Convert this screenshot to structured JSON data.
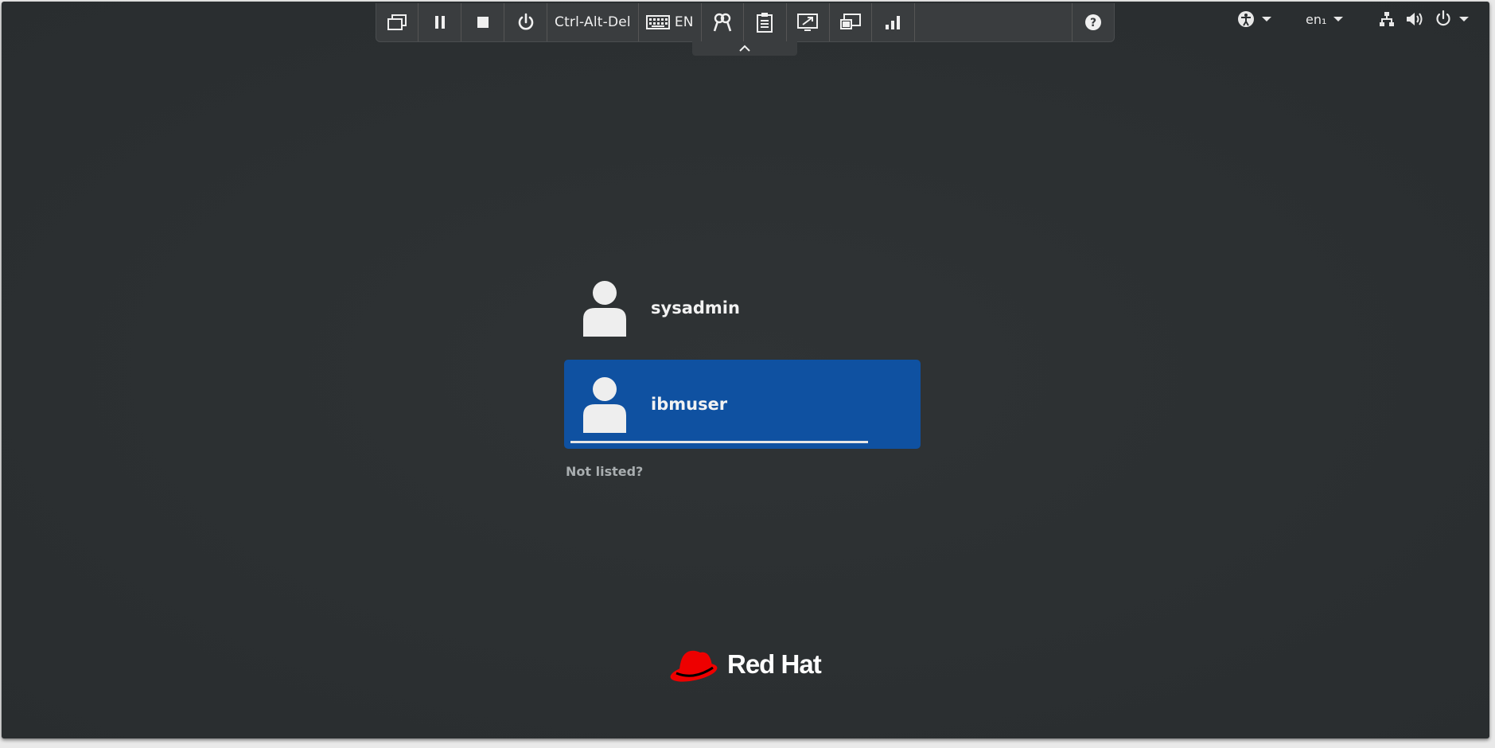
{
  "toolbar": {
    "items": [
      {
        "name": "send-keys",
        "icon": "windows-icon"
      },
      {
        "name": "pause",
        "icon": "pause-icon"
      },
      {
        "name": "stop",
        "icon": "stop-icon"
      },
      {
        "name": "power",
        "icon": "power-icon"
      },
      {
        "name": "ctrl-alt-del",
        "label": "Ctrl-Alt-Del"
      },
      {
        "name": "keyboard",
        "icon": "keyboard-icon",
        "label": "EN"
      },
      {
        "name": "credentials",
        "icon": "keys-icon"
      },
      {
        "name": "clipboard",
        "icon": "clipboard-icon"
      },
      {
        "name": "fullscreen",
        "icon": "resize-icon"
      },
      {
        "name": "screens",
        "icon": "monitors-icon"
      },
      {
        "name": "stats",
        "icon": "signal-icon"
      },
      {
        "name": "help",
        "icon": "help-icon"
      }
    ],
    "ctrl_alt_del_label": "Ctrl-Alt-Del",
    "keyboard_label": "EN"
  },
  "topbar": {
    "language": "en₁"
  },
  "login": {
    "users": [
      {
        "name": "sysadmin",
        "selected": false
      },
      {
        "name": "ibmuser",
        "selected": true
      }
    ],
    "not_listed": "Not listed?"
  },
  "brand": {
    "text": "Red Hat",
    "logo_color": "#ee0000"
  },
  "colors": {
    "background": "#2b2f31",
    "selection": "#0f51a1"
  }
}
